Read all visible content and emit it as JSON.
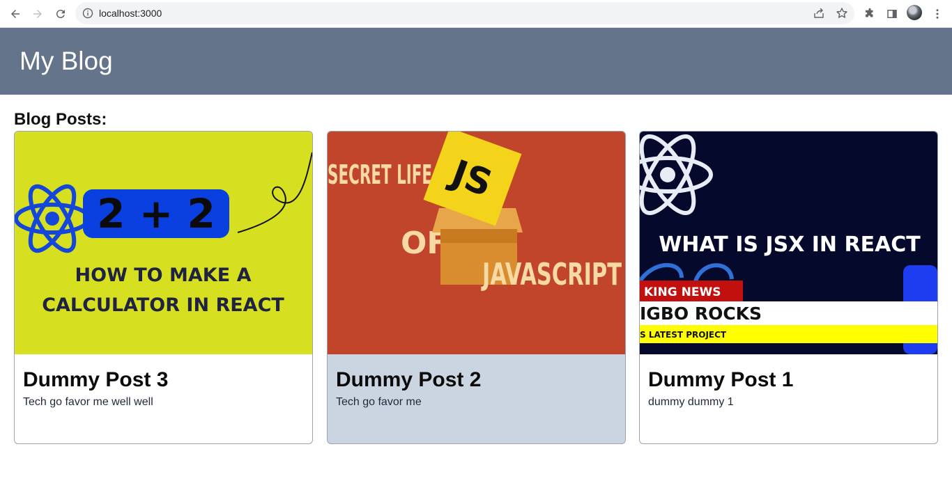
{
  "browser": {
    "url": "localhost:3000",
    "icons": [
      "back-arrow-icon",
      "forward-arrow-icon",
      "reload-icon",
      "info-icon",
      "share-icon",
      "star-icon",
      "extensions-icon",
      "side-panel-icon",
      "profile-avatar",
      "more-menu-icon"
    ]
  },
  "header": {
    "title": "My Blog",
    "background": "#64748b"
  },
  "main": {
    "section_title": "Blog Posts:",
    "posts": [
      {
        "title": "Dummy Post 3",
        "description": "Tech go favor me well well",
        "image_text": [
          "2 + 2",
          "HOW TO MAKE A",
          "CALCULATOR IN REACT"
        ],
        "image_bg": "#d6e021"
      },
      {
        "title": "Dummy Post 2",
        "description": "Tech go favor me",
        "image_text": [
          "SECRET LIFE",
          "OF",
          "JAVASCRIPT",
          "JS"
        ],
        "image_bg": "#c0452a"
      },
      {
        "title": "Dummy Post 1",
        "description": "dummy dummy 1",
        "image_text": [
          "WHAT IS JSX IN REACT",
          "KING NEWS",
          "IGBO ROCKS",
          "S LATEST PROJECT"
        ],
        "image_bg": "#050a2c"
      }
    ]
  }
}
